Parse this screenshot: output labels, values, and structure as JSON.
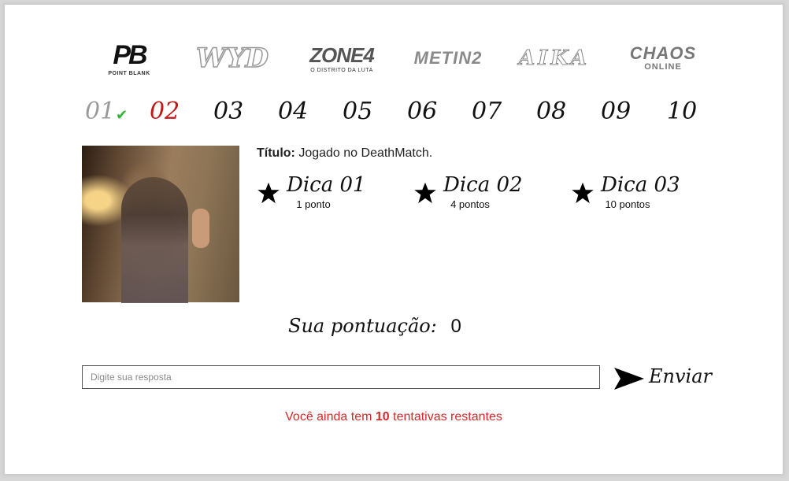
{
  "logos": [
    {
      "name": "point-blank-logo",
      "main": "PB",
      "sub": "POINT BLANK"
    },
    {
      "name": "wyd-logo",
      "main": "WYD",
      "sub": ""
    },
    {
      "name": "zone4-logo",
      "main": "ZONE4",
      "sub": "O DISTRITO DA LUTA"
    },
    {
      "name": "metin2-logo",
      "main": "METIN2",
      "sub": ""
    },
    {
      "name": "aika-logo",
      "main": "AIKA",
      "sub": ""
    },
    {
      "name": "chaos-online-logo",
      "main": "CHAOS",
      "sub": "ONLINE"
    }
  ],
  "questions": [
    "01",
    "02",
    "03",
    "04",
    "05",
    "06",
    "07",
    "08",
    "09",
    "10"
  ],
  "current_question": "02",
  "completed_check": "✔",
  "question": {
    "title_label": "Título:",
    "title_value": "Jogado no DeathMatch."
  },
  "tips": [
    {
      "label": "Dica 01",
      "points": "1 ponto"
    },
    {
      "label": "Dica 02",
      "points": "4 pontos"
    },
    {
      "label": "Dica 03",
      "points": "10 pontos"
    }
  ],
  "score": {
    "label": "Sua pontuação:",
    "value": "0"
  },
  "answer": {
    "placeholder": "Digite sua resposta",
    "send_label": "Enviar"
  },
  "remaining": {
    "prefix": "Você ainda tem",
    "count": "10",
    "suffix": "tentativas restantes"
  },
  "colors": {
    "active": "#c21818",
    "done": "#9a9a9a",
    "check": "#2fb82f",
    "warning": "#d42a2a"
  }
}
